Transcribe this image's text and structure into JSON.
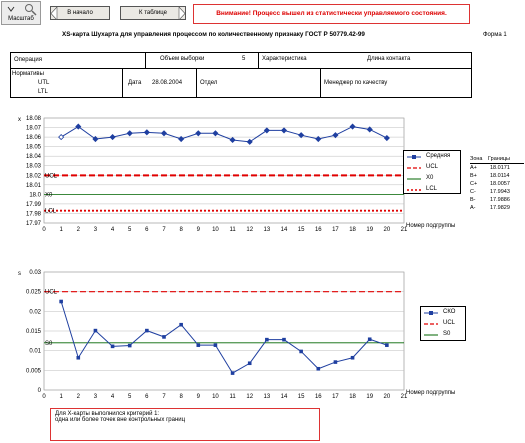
{
  "toolbar": {
    "zoom_label": "Масштаб",
    "back_label": "В начало",
    "table_label": "К таблице",
    "warning": "Внимание! Процесс вышел из статистически управляемого состояния."
  },
  "header": {
    "title": "XS-карта Шухарта для управления процессом по количественному признаку ГОСТ Р 50779.42-99",
    "form": "Форма 1"
  },
  "info": {
    "operation_label": "Операция",
    "sample_label": "Объем выборки",
    "sample_value": "5",
    "characteristic_label": "Характеристика",
    "characteristic_value": "Длина контакта",
    "norms_label": "Нормативы",
    "utl_label": "UTL",
    "ltl_label": "LTL",
    "date_label": "Дата",
    "date_value": "28.08.2004",
    "dept_label": "Отдел",
    "manager_label": "Менеджер по качеству"
  },
  "zones": {
    "header_zone": "Зона",
    "header_bounds": "Границы",
    "rows": [
      {
        "zone": "A+",
        "value": "18.0171"
      },
      {
        "zone": "B+",
        "value": "18.0114"
      },
      {
        "zone": "C+",
        "value": "18.0057"
      },
      {
        "zone": "C-",
        "value": "17.9943"
      },
      {
        "zone": "B-",
        "value": "17.9886"
      },
      {
        "zone": "A-",
        "value": "17.9829"
      }
    ]
  },
  "chart_data": [
    {
      "type": "line",
      "ylabel": "x",
      "xlabel": "Номер подгруппы",
      "ylim": [
        17.97,
        18.08
      ],
      "xlim": [
        0,
        21
      ],
      "yticks": [
        "17.97",
        "17.98",
        "17.99",
        "18.0",
        "18.01",
        "18.02",
        "18.03",
        "18.04",
        "18.05",
        "18.06",
        "18.07",
        "18.08"
      ],
      "x": [
        1,
        2,
        3,
        4,
        5,
        6,
        7,
        8,
        9,
        10,
        11,
        12,
        13,
        14,
        15,
        16,
        17,
        18,
        19,
        20
      ],
      "series": [
        {
          "name": "Средняя",
          "values": [
            18.06,
            18.071,
            18.058,
            18.06,
            18.064,
            18.065,
            18.064,
            18.058,
            18.064,
            18.064,
            18.057,
            18.055,
            18.067,
            18.067,
            18.062,
            18.058,
            18.062,
            18.071,
            18.068,
            18.059
          ]
        },
        {
          "name": "UCL",
          "constant": 18.0199
        },
        {
          "name": "X0",
          "constant": 18.0
        },
        {
          "name": "LCL",
          "constant": 17.9829
        }
      ],
      "line_labels": {
        "ucl": "UCL",
        "x0": "X0",
        "lcl": "LCL"
      },
      "colors": {
        "mean": "#1f3fa0",
        "ucl": "#e00000",
        "x0": "#006600",
        "lcl": "#e00000"
      }
    },
    {
      "type": "line",
      "ylabel": "s",
      "xlabel": "Номер подгруппы",
      "ylim": [
        0,
        0.03
      ],
      "xlim": [
        0,
        21
      ],
      "yticks": [
        "0",
        "0.005",
        "0.01",
        "0.015",
        "0.02",
        "0.025",
        "0.03"
      ],
      "x": [
        1,
        2,
        3,
        4,
        5,
        6,
        7,
        8,
        9,
        10,
        11,
        12,
        13,
        14,
        15,
        16,
        17,
        18,
        19,
        20
      ],
      "series": [
        {
          "name": "СКО",
          "values": [
            0.0225,
            0.0082,
            0.0151,
            0.0111,
            0.0113,
            0.0151,
            0.0135,
            0.0166,
            0.0114,
            0.0114,
            0.0043,
            0.0068,
            0.0128,
            0.0128,
            0.0098,
            0.0054,
            0.0071,
            0.0082,
            0.0129,
            0.0114
          ]
        },
        {
          "name": "UCL",
          "constant": 0.025
        },
        {
          "name": "S0",
          "constant": 0.012
        }
      ],
      "line_labels": {
        "ucl": "UCL",
        "s0": "S0"
      },
      "colors": {
        "sko": "#1f3fa0",
        "ucl": "#e00000",
        "s0": "#006600"
      }
    }
  ],
  "note": {
    "line1": "Для X-карты выполнился критерий 1:",
    "line2": "одна или более точек вне контрольных границ"
  }
}
